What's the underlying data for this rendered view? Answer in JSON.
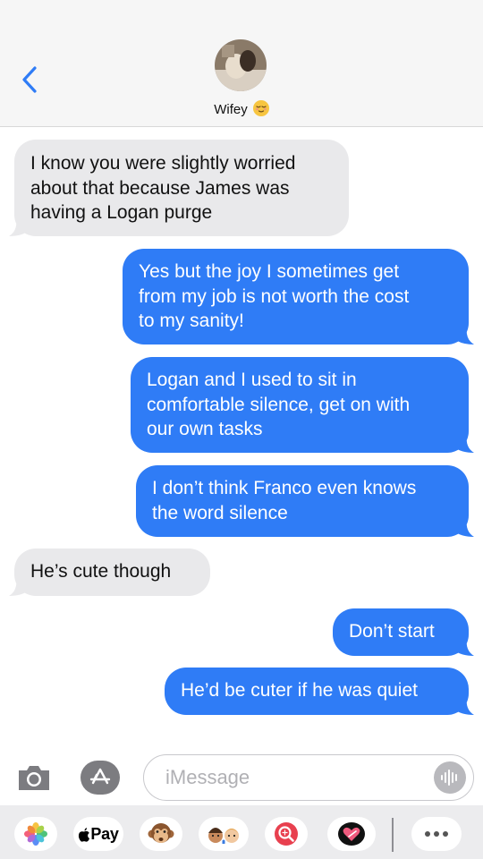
{
  "header": {
    "contact_name": "Wifey",
    "contact_emoji": "relieved-face-emoji"
  },
  "messages": [
    {
      "direction": "incoming",
      "lines": [
        "I know you were slightly worried",
        "about that because James was",
        "having a Logan purge"
      ]
    },
    {
      "direction": "outgoing",
      "lines": [
        "Yes but the joy I sometimes get",
        "from my job is not worth the cost",
        "to my sanity!"
      ]
    },
    {
      "direction": "outgoing",
      "lines": [
        "Logan and I used to sit in",
        "comfortable silence, get on with",
        "our own tasks"
      ]
    },
    {
      "direction": "outgoing",
      "lines": [
        "I don’t think Franco even knows",
        "the word silence"
      ]
    },
    {
      "direction": "incoming",
      "lines": [
        "He’s cute though"
      ]
    },
    {
      "direction": "outgoing",
      "lines": [
        "Don’t start"
      ]
    },
    {
      "direction": "outgoing",
      "lines": [
        "He’d be cuter if he was quiet"
      ]
    }
  ],
  "input": {
    "placeholder": "iMessage",
    "value": ""
  },
  "app_drawer": {
    "apple_pay_label": "Pay",
    "apps": [
      "photos-icon",
      "apple-pay-icon",
      "animoji-icon",
      "memoji-icon",
      "image-search-icon",
      "digital-touch-icon",
      "more-icon"
    ]
  },
  "colors": {
    "outgoing_bubble": "#2f7cf6",
    "incoming_bubble": "#e9e9eb",
    "accent": "#2f7cf6"
  }
}
